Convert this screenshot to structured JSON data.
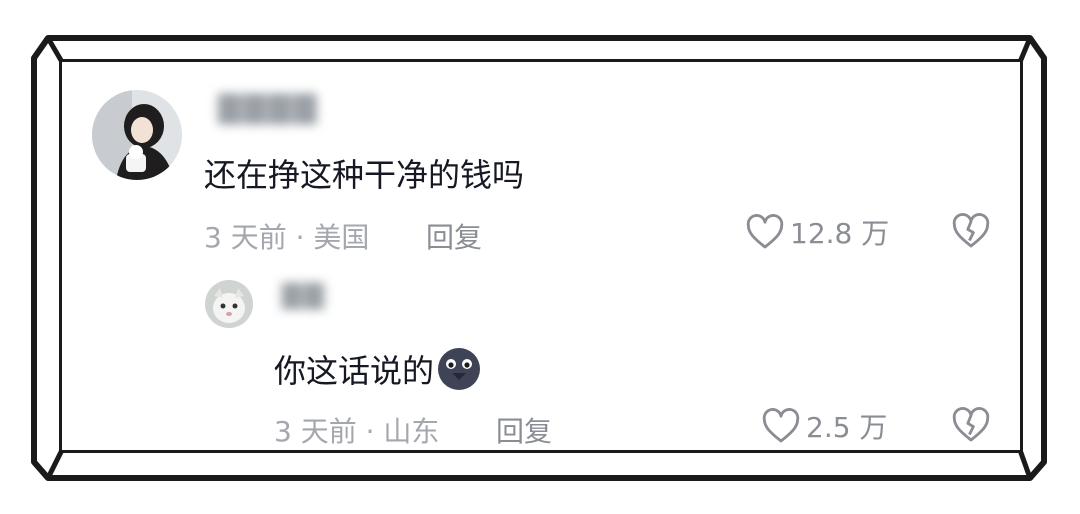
{
  "comments": [
    {
      "username": "▇▇▇▇",
      "text": "还在挣这种干净的钱吗",
      "time_location": "3 天前 · 美国",
      "reply_label": "回复",
      "like_count": "12.8 万"
    }
  ],
  "replies": [
    {
      "username": "▇▇",
      "text": "你这话说的",
      "emoji": "dark-bird-emoji",
      "time_location": "3 天前 · 山东",
      "reply_label": "回复",
      "like_count": "2.5 万"
    }
  ],
  "colors": {
    "text_primary": "#161823",
    "text_secondary": "#a4a7ae",
    "icon": "#8a8d94",
    "frame": "#1a1a1a"
  },
  "icons": [
    "heart-icon",
    "broken-heart-icon"
  ]
}
